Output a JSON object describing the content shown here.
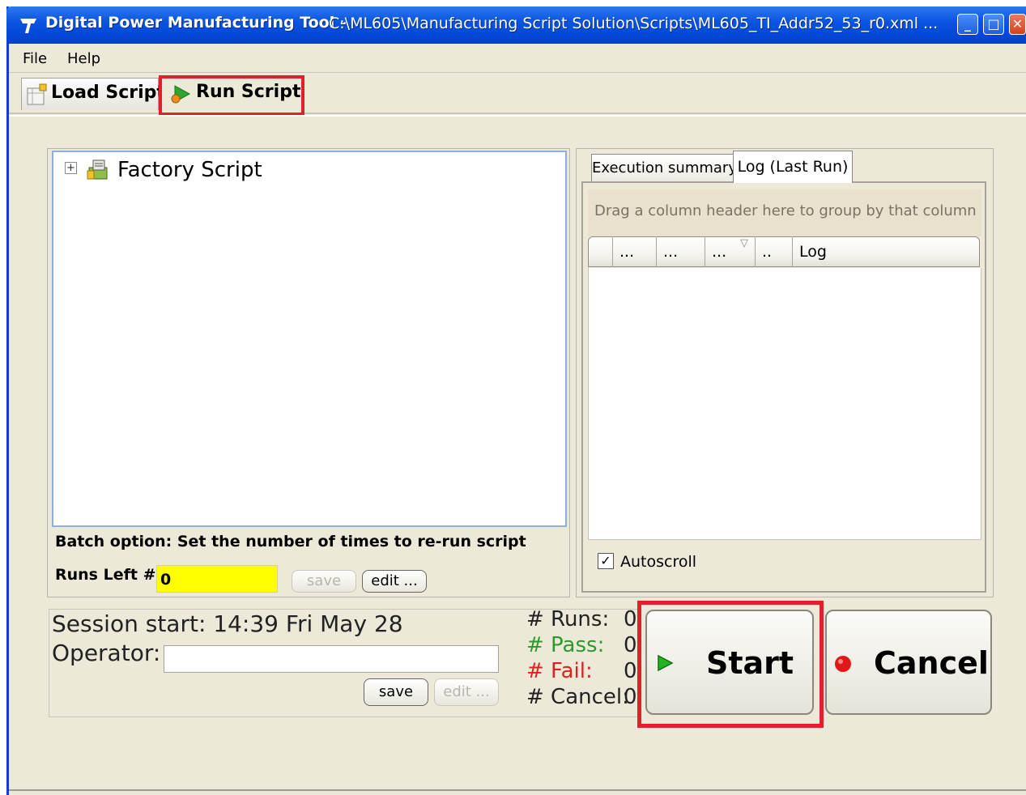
{
  "window": {
    "app_title": "Digital Power Manufacturing Tool -",
    "file_path": "C:\\ML605\\Manufacturing Script Solution\\Scripts\\ML605_TI_Addr52_53_r0.xml ..."
  },
  "menu": {
    "file": "File",
    "help": "Help"
  },
  "tabs": {
    "load_script": "Load Script",
    "run_script": "Run Script"
  },
  "tree": {
    "root_label": "Factory Script",
    "expander": "+"
  },
  "batch": {
    "label": "Batch option: Set the number of times to re-run script",
    "runs_left_label": "Runs Left #",
    "runs_left_value": "0",
    "save_label": "save",
    "edit_label": "edit ..."
  },
  "right_panel": {
    "tab_exec": "Execution summary",
    "tab_log": "Log (Last Run)",
    "group_hint": "Drag a column header here to group by that column",
    "columns": [
      "...",
      "...",
      "...",
      "..",
      "Log"
    ],
    "sort_glyph": "▽",
    "autoscroll_label": "Autoscroll",
    "autoscroll_check": "✓"
  },
  "session": {
    "start_label": "Session start:",
    "start_value": "14:39 Fri May 28",
    "operator_label": "Operator:",
    "operator_value": "",
    "save_label": "save",
    "edit_label": "edit ..."
  },
  "stats": {
    "runs_label": "# Runs:",
    "runs_value": "0",
    "pass_label": "# Pass:",
    "pass_value": "0",
    "fail_label": "# Fail:",
    "fail_value": "0",
    "cancel_label": "# Cancel:",
    "cancel_value": "0"
  },
  "actions": {
    "start_label": "Start",
    "cancel_label": "Cancel"
  },
  "colors": {
    "titlebar": "#0a55e0",
    "highlight": "#e0202a",
    "runs_input_bg": "#ffff00",
    "pass_text": "#2e9a2e",
    "fail_text": "#e02020",
    "start_icon": "#22b422",
    "cancel_icon": "#e01818"
  },
  "icons": {
    "app": "ti-logo-icon",
    "load": "script-page-icon",
    "run": "run-arrow-icon",
    "tree": "factory-script-icon",
    "start": "play-triangle-icon",
    "cancel": "red-dot-icon"
  }
}
